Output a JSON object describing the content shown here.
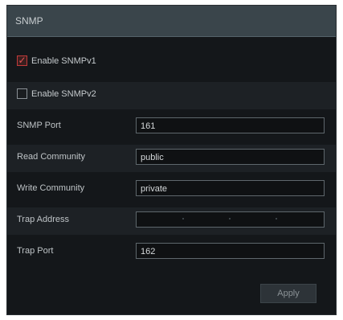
{
  "panel": {
    "title": "SNMP"
  },
  "options": {
    "snmpv1": {
      "label": "Enable SNMPv1",
      "checked": true
    },
    "snmpv2": {
      "label": "Enable SNMPv2",
      "checked": false
    }
  },
  "fields": {
    "snmp_port": {
      "label": "SNMP Port",
      "value": "161"
    },
    "read_community": {
      "label": "Read Community",
      "value": "public"
    },
    "write_community": {
      "label": "Write Community",
      "value": "private"
    },
    "trap_address": {
      "label": "Trap Address",
      "value": ""
    },
    "trap_port": {
      "label": "Trap Port",
      "value": "162"
    }
  },
  "actions": {
    "apply_label": "Apply"
  }
}
